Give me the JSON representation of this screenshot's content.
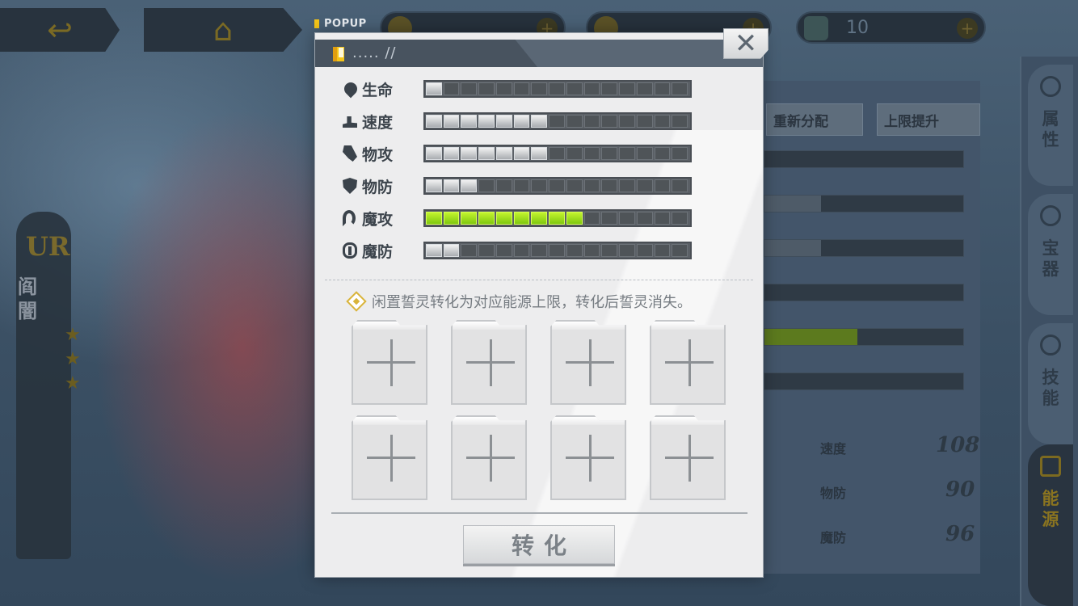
{
  "background": {
    "resource_3_value": "10",
    "character": {
      "rarity": "UR",
      "name": "阎闇"
    },
    "panel_buttons": [
      "重新分配",
      "上限提升"
    ],
    "bg_stats": [
      {
        "label": "速度",
        "value": "108"
      },
      {
        "label": "物防",
        "value": "90"
      },
      {
        "label": "魔防",
        "value": "96"
      }
    ],
    "side_tabs": [
      "属性",
      "宝器",
      "技能",
      "能源"
    ]
  },
  "popup": {
    "tag": "POPUP",
    "title": "..... //",
    "close_glyph": "✕",
    "stats": [
      {
        "label": "生命",
        "icon": "drop-icon",
        "filled": 1,
        "total": 15,
        "color": "silver"
      },
      {
        "label": "速度",
        "icon": "boot-icon",
        "filled": 7,
        "total": 15,
        "color": "silver"
      },
      {
        "label": "物攻",
        "icon": "sword-icon",
        "filled": 7,
        "total": 15,
        "color": "silver"
      },
      {
        "label": "物防",
        "icon": "shield-icon",
        "filled": 3,
        "total": 15,
        "color": "silver"
      },
      {
        "label": "魔攻",
        "icon": "wand-icon",
        "filled": 9,
        "total": 15,
        "color": "green"
      },
      {
        "label": "魔防",
        "icon": "magic-shield-icon",
        "filled": 2,
        "total": 15,
        "color": "silver"
      }
    ],
    "hint": "闲置誓灵转化为对应能源上限，转化后誓灵消失。",
    "slot_count": 8,
    "convert_label": "转化"
  },
  "colors": {
    "accent_yellow": "#f5c518",
    "green_fill": "#9ee01e",
    "silver_fill": "#d8dadd"
  }
}
